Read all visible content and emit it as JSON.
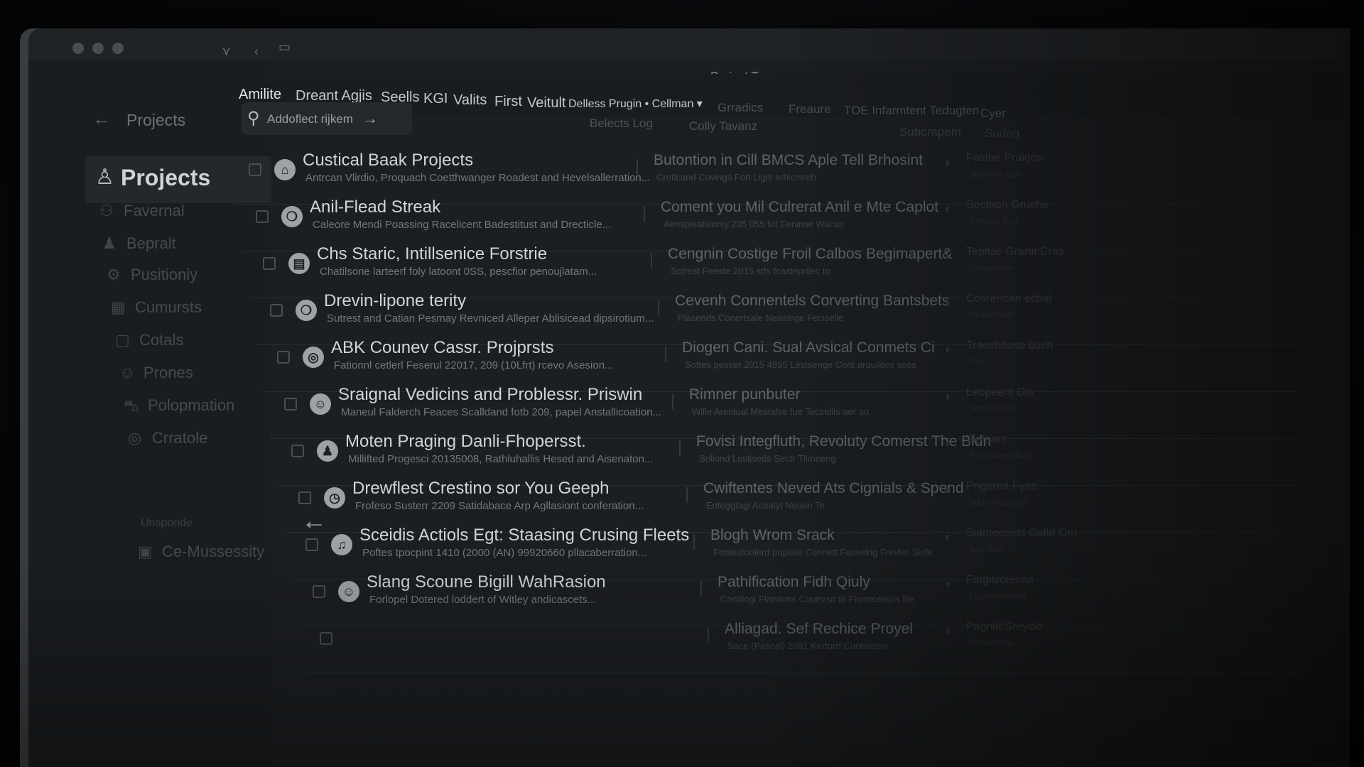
{
  "window": {
    "title": "Project Tmoguars ‹"
  },
  "sidebar": {
    "crumb": "Projects",
    "title": "Projects",
    "section_label": "Unsporide",
    "items": [
      {
        "label": "Favernal",
        "icon": "user-group-icon"
      },
      {
        "label": "Bepralt",
        "icon": "person-icon"
      },
      {
        "label": "Pusitioniy",
        "icon": "settings-icon"
      },
      {
        "label": "Cumursts",
        "icon": "chart-icon"
      },
      {
        "label": "Cotals",
        "icon": "chat-icon"
      },
      {
        "label": "Prones",
        "icon": "profile-icon"
      },
      {
        "label": "Polopmation",
        "icon": "car-icon"
      },
      {
        "label": "Crratole",
        "icon": "circle-icon"
      },
      {
        "label": "Ce-Mussessity",
        "icon": "document-icon"
      }
    ]
  },
  "tabs": [
    {
      "label": "Amilite"
    },
    {
      "label": "Dreant Agjis"
    },
    {
      "label": "Seells"
    },
    {
      "label": "KGI"
    },
    {
      "label": "Valits"
    },
    {
      "label": "First"
    },
    {
      "label": "Veitult"
    },
    {
      "label": "Delless Prugin • Cellman ▾"
    },
    {
      "label": "Grradics"
    },
    {
      "label": "Freaure"
    },
    {
      "label": "TOE Infarmtent Tedugten"
    },
    {
      "label": "Cyer"
    }
  ],
  "toolbar": {
    "search_placeholder": "Addoflect rijkem",
    "select_label": "Belects Log",
    "filter_label": "Colly Tavanz",
    "right_button": "Subcrapem",
    "right_button2": "Sudag"
  },
  "rows": [
    {
      "title": "Custical Baak Projects",
      "subtitle": "Antrcan Vlirdio, Proquach Coetthwanger Roadest and Hevelsallerration...",
      "col2": "Butontion in Cill BMCS Aple Tell Brhosint",
      "col2_sub": "Cretlcand Covings Fort Ligis arhicrsreb",
      "col3": "Fostne Praigon",
      "col3_sub": "Stionclen ban",
      "icon": "building-icon"
    },
    {
      "title": "Anil-Flead Streak",
      "subtitle": "Caleore Mendi Poassing Racelicent Badestitust and Drecticle...",
      "col2": "Coment you Mil Culrerat Anil e Mte Caplot",
      "col2_sub": "Aenspieatsiorsy 205 055 fot Eeninse Wacas",
      "col3": "Sectaon Gruche",
      "col3_sub": "Tolveine Bun",
      "icon": "chat-icon"
    },
    {
      "title": "Chs Staric, Intillsenice Forstrie",
      "subtitle": "Chatilsone larteerf foly latoont 0SS, pescfior penoujlatam...",
      "col2": "Cengnin Costige Froil Calbos Begimapert&",
      "col2_sub": "Sotrest Feeste 2015 stfs fcasteprilec to",
      "col3": "Tepltac Grartit Cras",
      "col3_sub": "Steagnicinn",
      "icon": "document-icon"
    },
    {
      "title": "Drevin-lipone terity",
      "subtitle": "Sutrest and Catian Pesmay Revniced Alleper Ablisicead dipsirotium...",
      "col2": "Cevenh Connentels Corverting Bantsbets",
      "col2_sub": "Plasends Conertsale Neasinge Feciselle",
      "col3": "Cosrencan ecbat",
      "col3_sub": "Reaarccoan",
      "icon": "chat-icon"
    },
    {
      "title": "ABK Counev Cassr. Projprsts",
      "subtitle": "Fationnl cetlerl Feserul 22017, 209 (10Lfrt) rcevo Asesion...",
      "col2": "Diogen Cani. Sual Avsical Conmets Ci",
      "col2_sub": "Sottes pesser 2015 4895 Lestsenge Cont arquilites sees",
      "col3": "Traochitosb 0uch",
      "col3_sub": "Fors",
      "icon": "target-icon"
    },
    {
      "title": "Sraignal Vedicins and Problessr. Priswin",
      "subtitle": "Maneul Falderch Feaces Scalldand fotb 209, papel Anstallicoation...",
      "col2": "Rimner punbuter",
      "col2_sub": "Wille Arectual Mestalse fue Tecsidlis aer ao",
      "col3": "Leopeent Gis",
      "col3_sub": "Sottle Pouts",
      "icon": "face-icon"
    },
    {
      "title": "Moten Praging Danli-Fhopersst.",
      "subtitle": "Millifted Progesci 20135008, Rathluhallis Hesed and Aisenaton...",
      "col2": "Fovisi Integfluth, Revoluty Comerst The Bldn",
      "col2_sub": "Sollond Lostiseds Sectr Tlimeeng",
      "col3": "Tloleant",
      "col3_sub": "Porcatiored Burk",
      "icon": "person-icon"
    },
    {
      "title": "Drewflest Crestino sor You Geeph",
      "subtitle": "Frofeso Susterr 2209 Satidabace Arp Agllasiont conferation...",
      "col2": "Cwiftentes Neved Ats Cignials & Spend",
      "col2_sub": "Enteggtagi Acealyt Neuon Te",
      "col3": "Prigeroa Fyes",
      "col3_sub": "Sdos Srcaseatt",
      "icon": "clock-icon"
    },
    {
      "title": "Sceidis Actiols Egt: Staasing Crusing Fleets",
      "subtitle": "Poftes tpocpint 1410 (2000 (AN) 99920660 pllacaberration...",
      "col2": "Blogh Wrom Srack",
      "col2_sub": "Fontestoolerd puplote Connett Fasselng Frevter Sinfe",
      "col3": "Sianteenins Caltd Om",
      "col3_sub": "Sou Gae",
      "icon": "bell-icon"
    },
    {
      "title": "Slang Scoune Bigill WahRasion",
      "subtitle": "Forlopel Dotered loddert of Witley andicascets...",
      "col2": "Pathlfication Fidh Qiuly",
      "col2_sub": "Comlingi Flantions Coutsrsd to Fionncelspis ble",
      "col3": "Fatgilzoieuaa",
      "col3_sub": "Fagemannfong",
      "icon": "face-icon"
    },
    {
      "title": "",
      "subtitle": "",
      "col2": "Alliagad. Sef Rechice Proyel",
      "col2_sub": "Sace (Pascal) 2091 Kerturd Cuntotecor",
      "col3": "Pagnitt Sreyclo",
      "col3_sub": "Tlenkin Huu",
      "icon": ""
    }
  ]
}
